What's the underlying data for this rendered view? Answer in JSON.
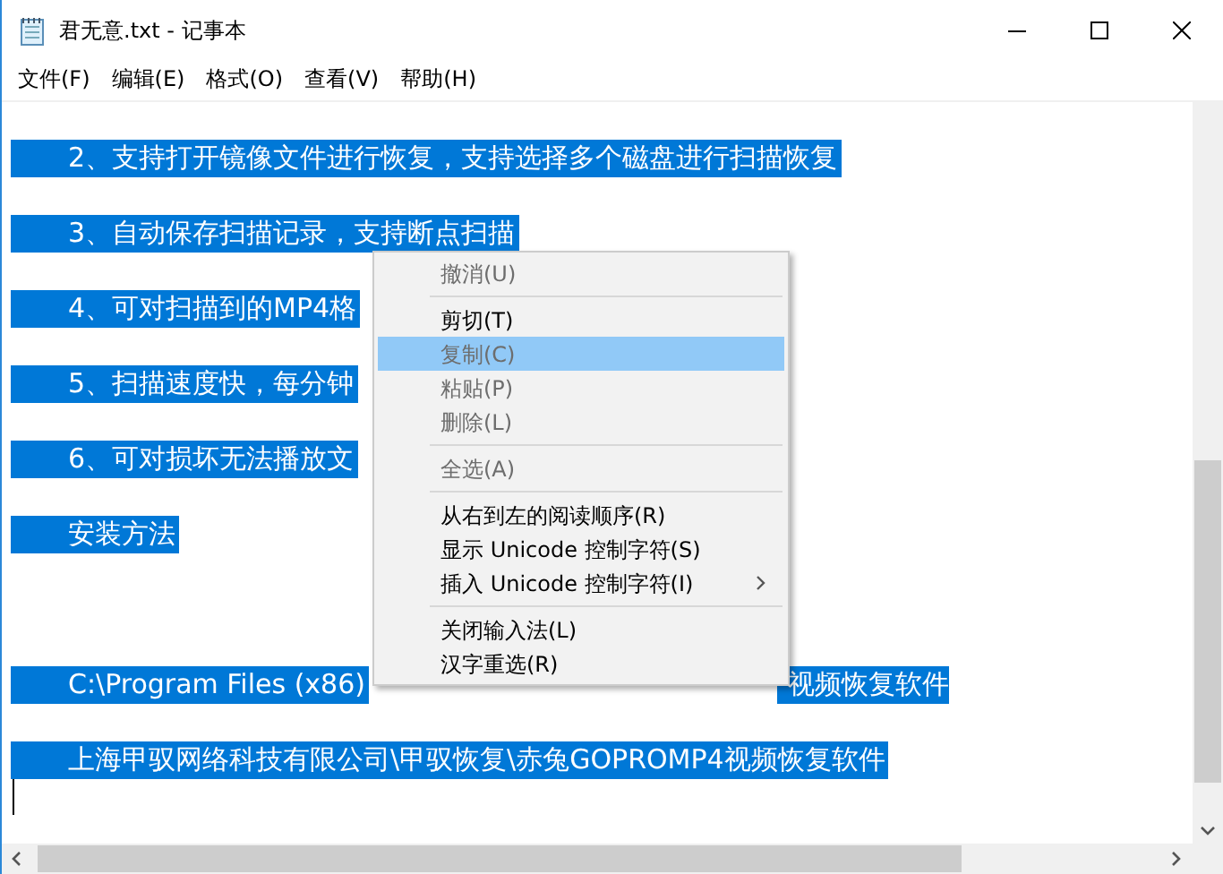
{
  "window": {
    "title": "君无意.txt - 记事本"
  },
  "menu_bar": [
    "文件(F)",
    "编辑(E)",
    "格式(O)",
    "查看(V)",
    "帮助(H)"
  ],
  "editor": {
    "lines": [
      {
        "kind": "blank"
      },
      {
        "kind": "text",
        "text": "2、支持打开镜像文件进行恢复，支持选择多个磁盘进行扫描恢复",
        "selected": true
      },
      {
        "kind": "blank"
      },
      {
        "kind": "text",
        "text": "3、自动保存扫描记录，支持断点扫描",
        "selected": true
      },
      {
        "kind": "blank"
      },
      {
        "kind": "text",
        "text": "4、可对扫描到的MP4格",
        "selected": true
      },
      {
        "kind": "blank"
      },
      {
        "kind": "text",
        "text": "5、扫描速度快，每分钟",
        "selected": true
      },
      {
        "kind": "blank"
      },
      {
        "kind": "text",
        "text": "6、可对损坏无法播放文",
        "selected": true
      },
      {
        "kind": "blank"
      },
      {
        "kind": "text",
        "text": "安装方法",
        "selected": true
      },
      {
        "kind": "blank"
      },
      {
        "kind": "blank"
      },
      {
        "kind": "blank"
      },
      {
        "kind": "text",
        "text": "C:\\Program Files (x86)",
        "tail": "视频恢复软件",
        "selected": true
      },
      {
        "kind": "blank"
      },
      {
        "kind": "text",
        "text": "上海甲驭网络科技有限公司\\甲驭恢复\\赤兔GOPROMP4视频恢复软件",
        "selected": true
      }
    ]
  },
  "context_menu": {
    "items": [
      {
        "kind": "item",
        "label": "撤消(U)",
        "disabled": true,
        "selected": false
      },
      {
        "kind": "separator"
      },
      {
        "kind": "item",
        "label": "剪切(T)",
        "disabled": false,
        "selected": false
      },
      {
        "kind": "item",
        "label": "复制(C)",
        "disabled": true,
        "selected": true
      },
      {
        "kind": "item",
        "label": "粘贴(P)",
        "disabled": true,
        "selected": false
      },
      {
        "kind": "item",
        "label": "删除(L)",
        "disabled": true,
        "selected": false
      },
      {
        "kind": "separator"
      },
      {
        "kind": "item",
        "label": "全选(A)",
        "disabled": true,
        "selected": false
      },
      {
        "kind": "separator"
      },
      {
        "kind": "item",
        "label": "从右到左的阅读顺序(R)",
        "disabled": false,
        "selected": false
      },
      {
        "kind": "item",
        "label": "显示 Unicode 控制字符(S)",
        "disabled": false,
        "selected": false
      },
      {
        "kind": "submenu",
        "label": "插入 Unicode 控制字符(I)",
        "disabled": false,
        "selected": false
      },
      {
        "kind": "separator"
      },
      {
        "kind": "item",
        "label": "关闭输入法(L)",
        "disabled": false,
        "selected": false
      },
      {
        "kind": "item",
        "label": "汉字重选(R)",
        "disabled": false,
        "selected": false
      }
    ]
  }
}
